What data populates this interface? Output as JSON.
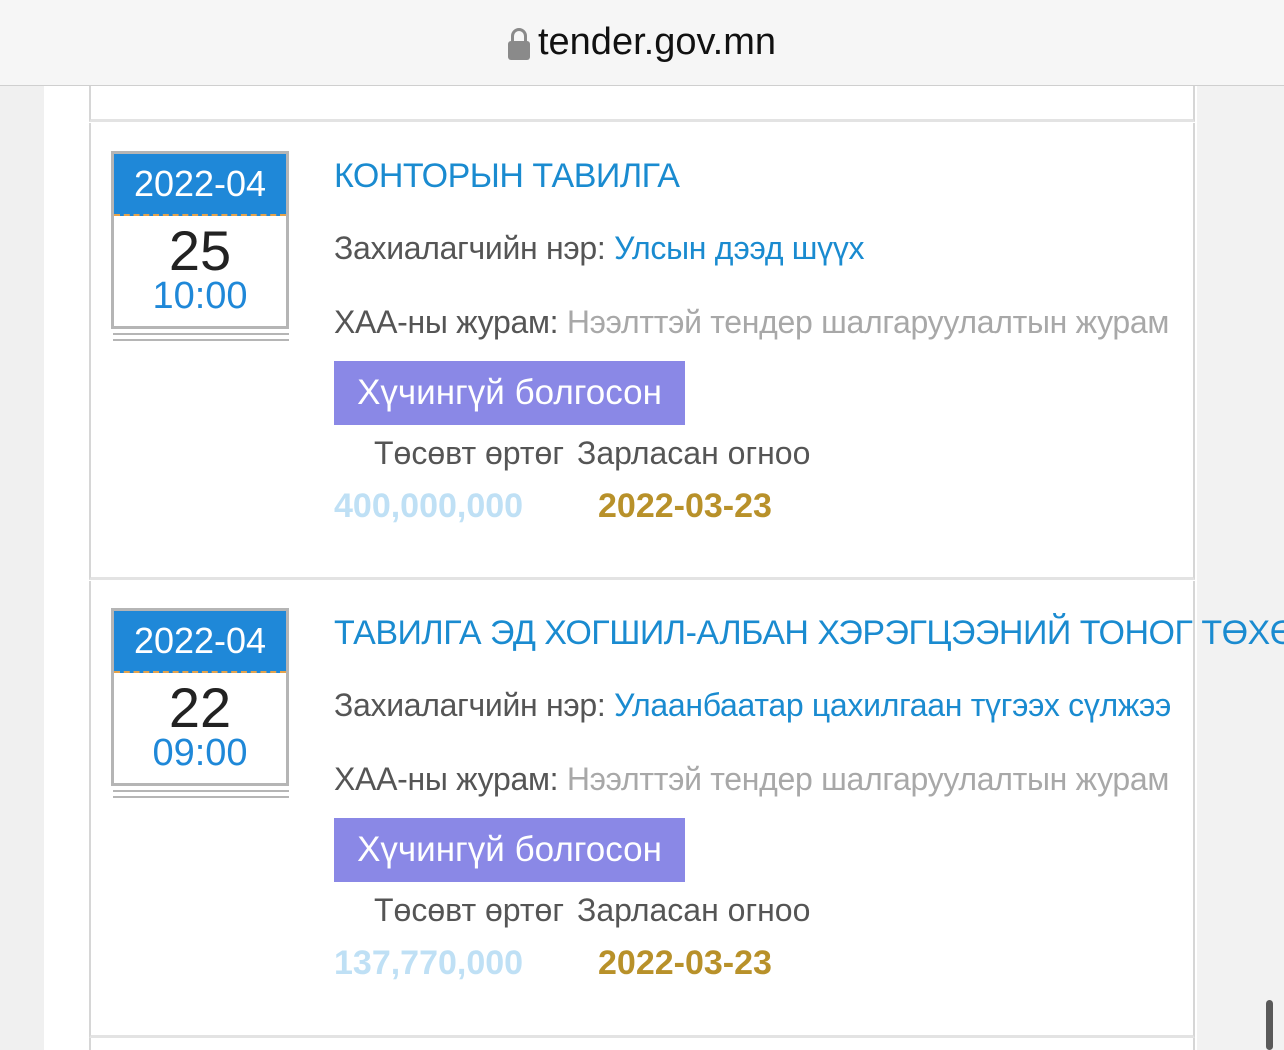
{
  "browser": {
    "url": "tender.gov.mn"
  },
  "tenders": [
    {
      "cal_month": "2022-04",
      "cal_day": "25",
      "cal_time": "10:00",
      "title": "КОНТОРЫН ТАВИЛГА",
      "customer_label": "Захиалагчийн нэр:",
      "customer": "Улсын дээд шүүх",
      "procedure_label": "ХАА-ны журам:",
      "procedure": "Нээлттэй тендер шалгаруулалтын журам",
      "status": "Хүчингүй болгосон",
      "budget_label": "Төсөвт өртөг",
      "announced_label": "Зарласан огноо",
      "budget": "400,000,000",
      "announced": "2022-03-23"
    },
    {
      "cal_month": "2022-04",
      "cal_day": "22",
      "cal_time": "09:00",
      "title": "ТАВИЛГА ЭД ХОГШИЛ-АЛБАН ХЭРЭГЦЭЭНИЙ ТОНОГ ТӨХӨӨ",
      "customer_label": "Захиалагчийн нэр:",
      "customer": "Улаанбаатар цахилгаан түгээх сүлжээ",
      "procedure_label": "ХАА-ны журам:",
      "procedure": "Нээлттэй тендер шалгаруулалтын журам",
      "status": "Хүчингүй болгосон",
      "budget_label": "Төсөвт өртөг",
      "announced_label": "Зарласан огноо",
      "budget": "137,770,000",
      "announced": "2022-03-23"
    }
  ]
}
